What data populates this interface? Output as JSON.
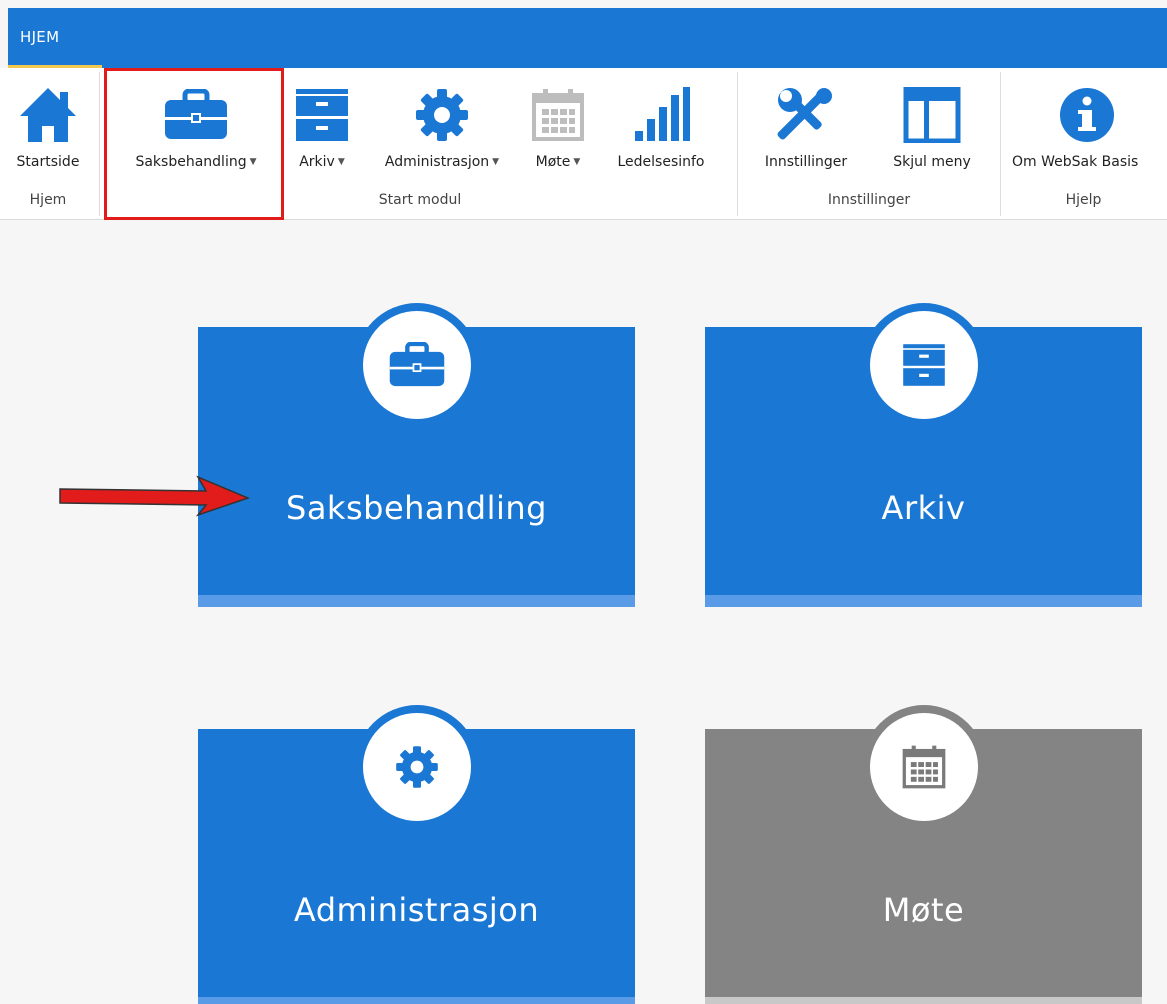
{
  "tabs": {
    "active": "HJEM"
  },
  "ribbon": {
    "buttons": {
      "startside": "Startside",
      "saksbehandling": "Saksbehandling",
      "arkiv": "Arkiv",
      "administrasjon": "Administrasjon",
      "mote": "Møte",
      "ledelsesinfo": "Ledelsesinfo",
      "innstillinger": "Innstillinger",
      "skjul_meny": "Skjul meny",
      "om_websak": "Om WebSak Basis"
    },
    "groups": {
      "hjem": "Hjem",
      "start_modul": "Start modul",
      "innstillinger": "Innstillinger",
      "hjelp": "Hjelp"
    },
    "icons": [
      "home-icon",
      "briefcase-icon",
      "cabinet-icon",
      "gear-icon",
      "calendar-icon",
      "bar-chart-icon",
      "tools-icon",
      "layout-icon",
      "info-icon"
    ]
  },
  "tiles": {
    "saksbehandling": "Saksbehandling",
    "arkiv": "Arkiv",
    "administrasjon": "Administrasjon",
    "mote": "Møte"
  },
  "colors": {
    "primary": "#1a77d4",
    "tile_band": "#5a9be8",
    "disabled_tile": "#848484",
    "highlight": "#e21b1b",
    "tab_underline": "#f2c94c"
  }
}
